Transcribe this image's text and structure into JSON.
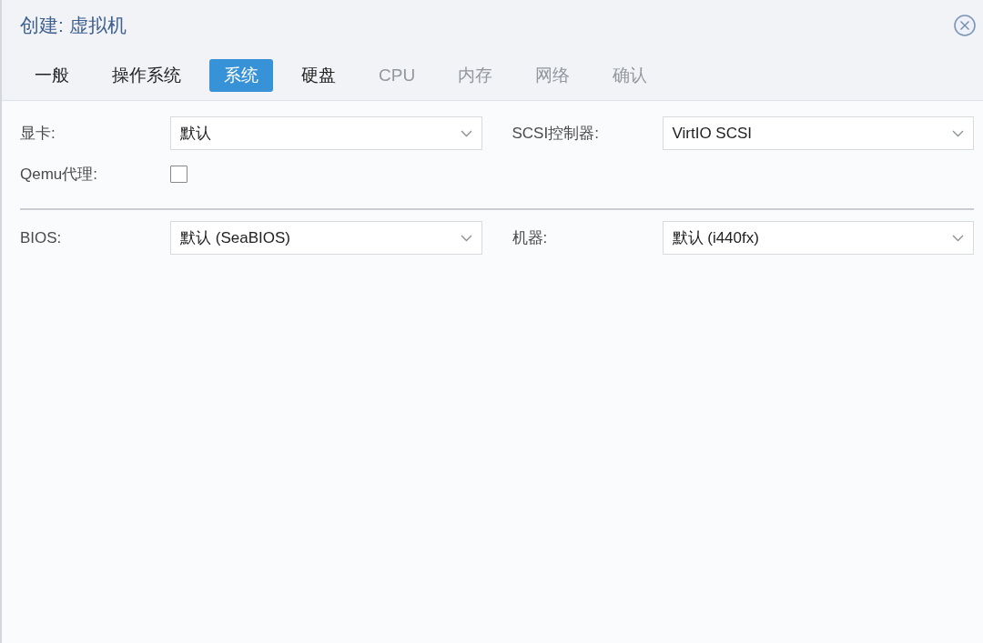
{
  "window": {
    "title": "创建: 虚拟机"
  },
  "tabs": [
    {
      "label": "一般",
      "selected": false,
      "disabled": false
    },
    {
      "label": "操作系统",
      "selected": false,
      "disabled": false
    },
    {
      "label": "系统",
      "selected": true,
      "disabled": false
    },
    {
      "label": "硬盘",
      "selected": false,
      "disabled": false
    },
    {
      "label": "CPU",
      "selected": false,
      "disabled": true
    },
    {
      "label": "内存",
      "selected": false,
      "disabled": true
    },
    {
      "label": "网络",
      "selected": false,
      "disabled": true
    },
    {
      "label": "确认",
      "selected": false,
      "disabled": true
    }
  ],
  "form": {
    "sections": [
      {
        "rows": [
          {
            "fields": [
              {
                "kind": "select",
                "label": "显卡:",
                "value": "默认"
              },
              {
                "kind": "select",
                "label": "SCSI控制器:",
                "value": "VirtIO SCSI"
              }
            ]
          },
          {
            "fields": [
              {
                "kind": "checkbox",
                "label": "Qemu代理:",
                "checked": false
              }
            ]
          }
        ]
      },
      {
        "rows": [
          {
            "fields": [
              {
                "kind": "select",
                "label": "BIOS:",
                "value": "默认 (SeaBIOS)"
              },
              {
                "kind": "select",
                "label": "机器:",
                "value": "默认 (i440fx)"
              }
            ]
          }
        ]
      }
    ]
  }
}
